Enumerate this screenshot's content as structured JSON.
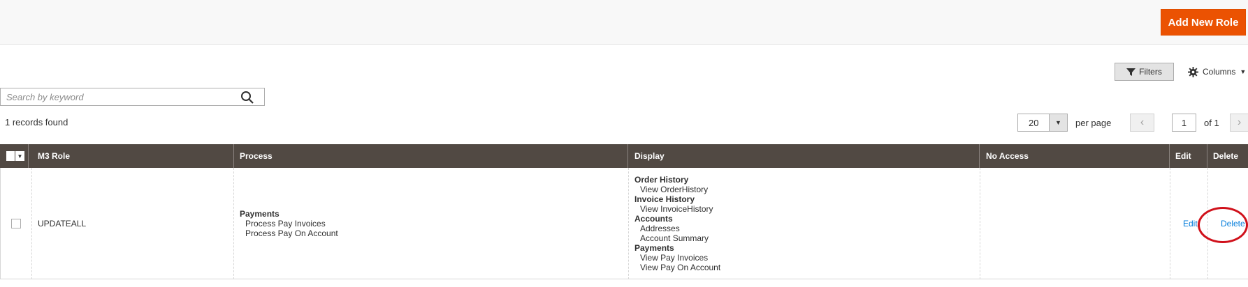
{
  "header": {
    "add_role_label": "Add New Role"
  },
  "toolbar": {
    "filters_label": "Filters",
    "columns_label": "Columns",
    "search_placeholder": "Search by keyword",
    "records_found": "1 records found",
    "per_page_value": "20",
    "per_page_label": "per page",
    "current_page": "1",
    "page_of": "of 1"
  },
  "grid": {
    "columns": {
      "role": "M3 Role",
      "process": "Process",
      "display": "Display",
      "no_access": "No Access",
      "edit": "Edit",
      "delete": "Delete"
    },
    "row": {
      "role": "UPDATEALL",
      "process": [
        {
          "group": "Payments",
          "items": [
            "Process Pay Invoices",
            "Process Pay On Account"
          ]
        }
      ],
      "display": [
        {
          "group": "Order History",
          "items": [
            "View OrderHistory"
          ]
        },
        {
          "group": "Invoice History",
          "items": [
            "View InvoiceHistory"
          ]
        },
        {
          "group": "Accounts",
          "items": [
            "Addresses",
            "Account Summary"
          ]
        },
        {
          "group": "Payments",
          "items": [
            "View Pay Invoices",
            "View Pay On Account"
          ]
        }
      ],
      "edit_label": "Edit",
      "delete_label": "Delete"
    }
  },
  "colors": {
    "accent": "#eb5202",
    "grid_header": "#514943",
    "link": "#007bdb",
    "highlight": "#d0111b"
  },
  "icons": [
    "search-icon",
    "filter-icon",
    "gear-icon",
    "caret-down-icon",
    "chevron-left-icon",
    "chevron-right-icon"
  ]
}
